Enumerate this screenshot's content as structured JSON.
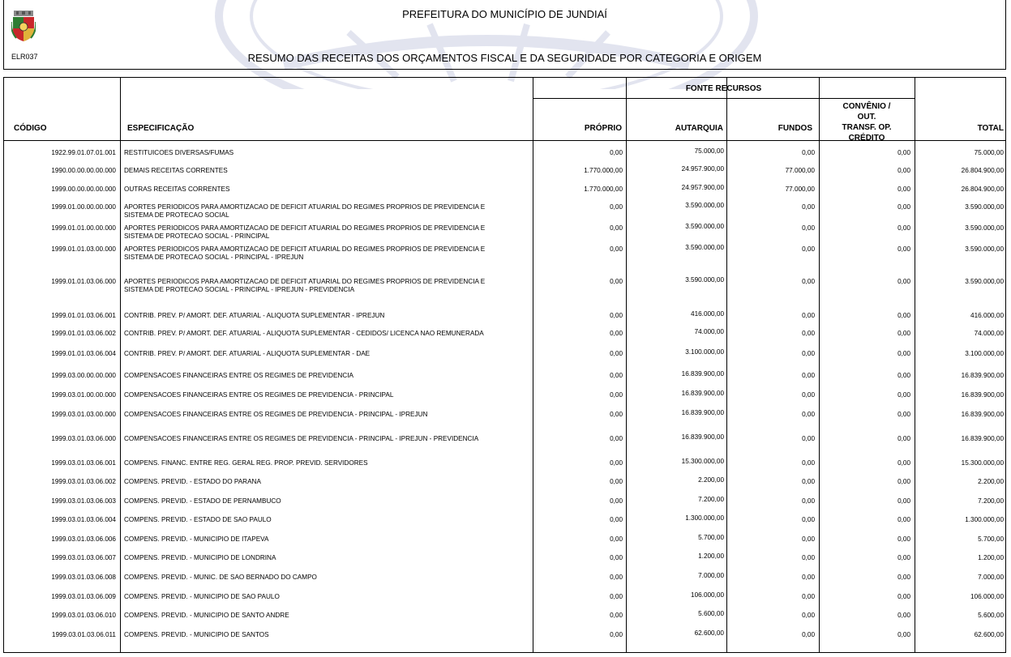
{
  "header": {
    "municipality": "PREFEITURA DO MUNICÍPIO DE JUNDIAÍ",
    "report_title": "RESUMO DAS RECEITAS DOS ORÇAMENTOS FISCAL E DA SEGURIDADE POR CATEGORIA E ORIGEM",
    "report_code": "ELR037",
    "crest_icon": "municipal-coat-of-arms"
  },
  "columns": {
    "codigo": "CÓDIGO",
    "especificacao": "ESPECIFICAÇÃO",
    "fonte_recursos": "FONTE RECURSOS",
    "proprio": "PRÓPRIO",
    "autarquia": "AUTARQUIA",
    "fundos": "FUNDOS",
    "convenio": "CONVÊNIO / OUT. TRANSF. OP. CRÉDITO",
    "total": "TOTAL"
  },
  "rows": [
    {
      "code": "1922.99.01.07.01.001",
      "spec": "RESTITUICOES DIVERSAS/FUMAS",
      "proprio": "0,00",
      "autarquia": "75.000,00",
      "fundos": "0,00",
      "convenio": "0,00",
      "total": "75.000,00"
    },
    {
      "code": "1990.00.00.00.00.000",
      "spec": "DEMAIS RECEITAS CORRENTES",
      "proprio": "1.770.000,00",
      "autarquia": "24.957.900,00",
      "fundos": "77.000,00",
      "convenio": "0,00",
      "total": "26.804.900,00"
    },
    {
      "code": "1999.00.00.00.00.000",
      "spec": "OUTRAS RECEITAS CORRENTES",
      "proprio": "1.770.000,00",
      "autarquia": "24.957.900,00",
      "fundos": "77.000,00",
      "convenio": "0,00",
      "total": "26.804.900,00"
    },
    {
      "code": "1999.01.00.00.00.000",
      "spec": "APORTES PERIODICOS PARA AMORTIZACAO DE DEFICIT ATUARIAL DO REGIMES PROPRIOS DE PREVIDENCIA E SISTEMA DE PROTECAO SOCIAL",
      "proprio": "0,00",
      "autarquia": "3.590.000,00",
      "fundos": "0,00",
      "convenio": "0,00",
      "total": "3.590.000,00"
    },
    {
      "code": "1999.01.01.00.00.000",
      "spec": "APORTES PERIODICOS PARA AMORTIZACAO DE DEFICIT ATUARIAL DO REGIMES PROPRIOS DE PREVIDENCIA E SISTEMA DE PROTECAO SOCIAL - PRINCIPAL",
      "proprio": "0,00",
      "autarquia": "3.590.000,00",
      "fundos": "0,00",
      "convenio": "0,00",
      "total": "3.590.000,00"
    },
    {
      "code": "1999.01.01.03.00.000",
      "spec": "APORTES PERIODICOS PARA AMORTIZACAO DE DEFICIT ATUARIAL DO REGIMES PROPRIOS DE PREVIDENCIA E SISTEMA DE PROTECAO SOCIAL - PRINCIPAL - IPREJUN",
      "proprio": "0,00",
      "autarquia": "3.590.000,00",
      "fundos": "0,00",
      "convenio": "0,00",
      "total": "3.590.000,00"
    },
    {
      "code": "1999.01.01.03.06.000",
      "spec": "APORTES PERIODICOS PARA AMORTIZACAO DE DEFICIT ATUARIAL DO REGIMES PROPRIOS DE PREVIDENCIA E SISTEMA DE PROTECAO SOCIAL - PRINCIPAL - IPREJUN - PREVIDENCIA",
      "proprio": "0,00",
      "autarquia": "3.590.000,00",
      "fundos": "0,00",
      "convenio": "0,00",
      "total": "3.590.000,00"
    },
    {
      "code": "1999.01.01.03.06.001",
      "spec": "CONTRIB. PREV. P/ AMORT. DEF. ATUARIAL - ALIQUOTA SUPLEMENTAR - IPREJUN",
      "proprio": "0,00",
      "autarquia": "416.000,00",
      "fundos": "0,00",
      "convenio": "0,00",
      "total": "416.000,00"
    },
    {
      "code": "1999.01.01.03.06.002",
      "spec": "CONTRIB. PREV. P/ AMORT. DEF. ATUARIAL - ALIQUOTA SUPLEMENTAR - CEDIDOS/ LICENCA NAO REMUNERADA",
      "proprio": "0,00",
      "autarquia": "74.000,00",
      "fundos": "0,00",
      "convenio": "0,00",
      "total": "74.000,00"
    },
    {
      "code": "1999.01.01.03.06.004",
      "spec": "CONTRIB. PREV. P/ AMORT. DEF. ATUARIAL - ALIQUOTA SUPLEMENTAR - DAE",
      "proprio": "0,00",
      "autarquia": "3.100.000,00",
      "fundos": "0,00",
      "convenio": "0,00",
      "total": "3.100.000,00"
    },
    {
      "code": "1999.03.00.00.00.000",
      "spec": "COMPENSACOES FINANCEIRAS ENTRE OS REGIMES DE PREVIDENCIA",
      "proprio": "0,00",
      "autarquia": "16.839.900,00",
      "fundos": "0,00",
      "convenio": "0,00",
      "total": "16.839.900,00"
    },
    {
      "code": "1999.03.01.00.00.000",
      "spec": "COMPENSACOES FINANCEIRAS ENTRE OS REGIMES DE PREVIDENCIA - PRINCIPAL",
      "proprio": "0,00",
      "autarquia": "16.839.900,00",
      "fundos": "0,00",
      "convenio": "0,00",
      "total": "16.839.900,00"
    },
    {
      "code": "1999.03.01.03.00.000",
      "spec": "COMPENSACOES FINANCEIRAS ENTRE OS REGIMES DE PREVIDENCIA - PRINCIPAL - IPREJUN",
      "proprio": "0,00",
      "autarquia": "16.839.900,00",
      "fundos": "0,00",
      "convenio": "0,00",
      "total": "16.839.900,00"
    },
    {
      "code": "1999.03.01.03.06.000",
      "spec": "COMPENSACOES FINANCEIRAS ENTRE OS REGIMES DE PREVIDENCIA - PRINCIPAL - IPREJUN - PREVIDENCIA",
      "proprio": "0,00",
      "autarquia": "16.839.900,00",
      "fundos": "0,00",
      "convenio": "0,00",
      "total": "16.839.900,00"
    },
    {
      "code": "1999.03.01.03.06.001",
      "spec": "COMPENS. FINANC. ENTRE REG. GERAL REG. PROP. PREVID. SERVIDORES",
      "proprio": "0,00",
      "autarquia": "15.300.000,00",
      "fundos": "0,00",
      "convenio": "0,00",
      "total": "15.300.000,00"
    },
    {
      "code": "1999.03.01.03.06.002",
      "spec": "COMPENS. PREVID. - ESTADO DO PARANA",
      "proprio": "0,00",
      "autarquia": "2.200,00",
      "fundos": "0,00",
      "convenio": "0,00",
      "total": "2.200,00"
    },
    {
      "code": "1999.03.01.03.06.003",
      "spec": "COMPENS. PREVID. - ESTADO DE PERNAMBUCO",
      "proprio": "0,00",
      "autarquia": "7.200,00",
      "fundos": "0,00",
      "convenio": "0,00",
      "total": "7.200,00"
    },
    {
      "code": "1999.03.01.03.06.004",
      "spec": "COMPENS. PREVID. - ESTADO DE SAO PAULO",
      "proprio": "0,00",
      "autarquia": "1.300.000,00",
      "fundos": "0,00",
      "convenio": "0,00",
      "total": "1.300.000,00"
    },
    {
      "code": "1999.03.01.03.06.006",
      "spec": "COMPENS. PREVID. - MUNICIPIO DE ITAPEVA",
      "proprio": "0,00",
      "autarquia": "5.700,00",
      "fundos": "0,00",
      "convenio": "0,00",
      "total": "5.700,00"
    },
    {
      "code": "1999.03.01.03.06.007",
      "spec": "COMPENS. PREVID. - MUNICIPIO DE LONDRINA",
      "proprio": "0,00",
      "autarquia": "1.200,00",
      "fundos": "0,00",
      "convenio": "0,00",
      "total": "1.200,00"
    },
    {
      "code": "1999.03.01.03.06.008",
      "spec": "COMPENS. PREVID. - MUNIC. DE SAO BERNADO DO CAMPO",
      "proprio": "0,00",
      "autarquia": "7.000,00",
      "fundos": "0,00",
      "convenio": "0,00",
      "total": "7.000,00"
    },
    {
      "code": "1999.03.01.03.06.009",
      "spec": "COMPENS. PREVID. - MUNICIPIO DE SAO PAULO",
      "proprio": "0,00",
      "autarquia": "106.000,00",
      "fundos": "0,00",
      "convenio": "0,00",
      "total": "106.000,00"
    },
    {
      "code": "1999.03.01.03.06.010",
      "spec": "COMPENS. PREVID. - MUNICIPIO DE SANTO ANDRE",
      "proprio": "0,00",
      "autarquia": "5.600,00",
      "fundos": "0,00",
      "convenio": "0,00",
      "total": "5.600,00"
    },
    {
      "code": "1999.03.01.03.06.011",
      "spec": "COMPENS. PREVID. - MUNICIPIO DE SANTOS",
      "proprio": "0,00",
      "autarquia": "62.600,00",
      "fundos": "0,00",
      "convenio": "0,00",
      "total": "62.600,00"
    }
  ]
}
